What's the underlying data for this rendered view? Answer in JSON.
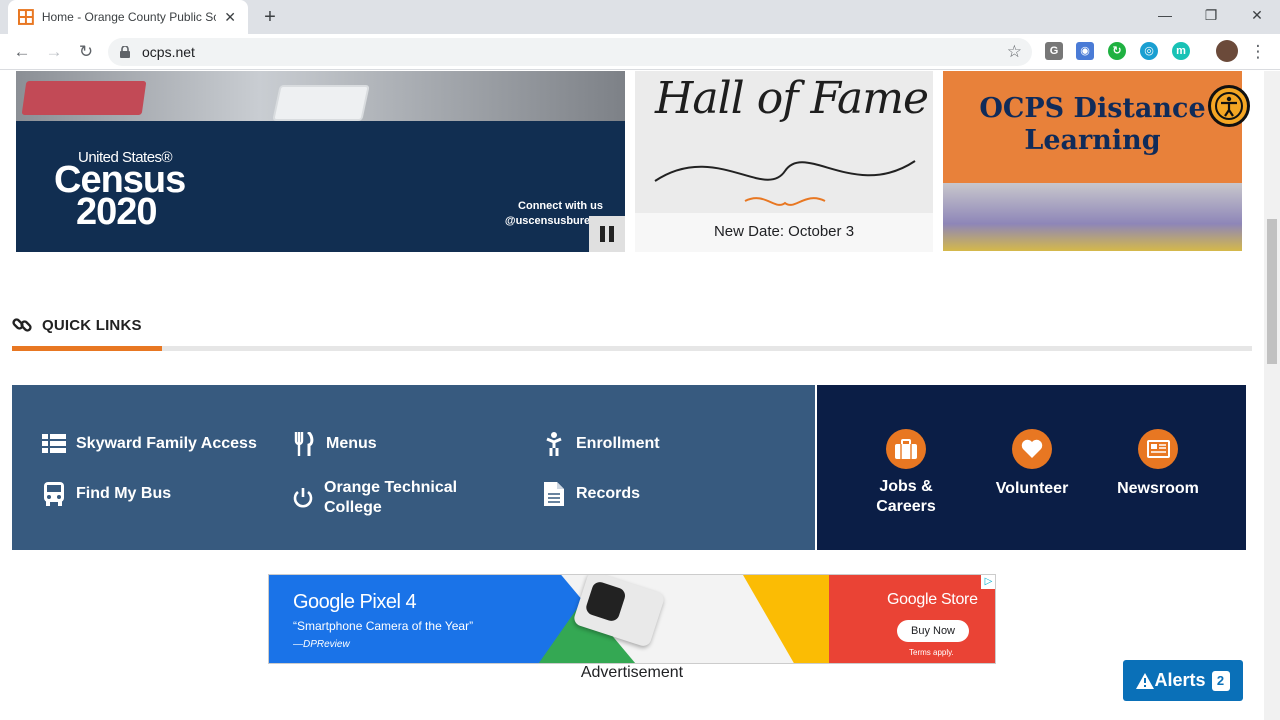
{
  "browser": {
    "tab_title": "Home - Orange County Public Sc",
    "tab_close": "✕",
    "new_tab": "+",
    "url": "ocps.net",
    "window_controls": [
      "—",
      "❐",
      "✕"
    ]
  },
  "hero": {
    "census": {
      "brand_line": "United States®",
      "brand_word": "Census",
      "brand_year": "2020",
      "connect": "Connect with us",
      "handle": "@uscensusbureau"
    },
    "hall_of_fame": {
      "script_title": "Hall of Fame",
      "caption": "New Date: October 3"
    },
    "distance_learning": {
      "title_line1": "OCPS Distance",
      "title_line2": "Learning"
    }
  },
  "quick_links": {
    "title": "QUICK LINKS",
    "items": [
      {
        "label": "Skyward Family Access",
        "icon": "list-icon"
      },
      {
        "label": "Menus",
        "icon": "utensils-icon"
      },
      {
        "label": "Enrollment",
        "icon": "child-icon"
      },
      {
        "label": "Find My Bus",
        "icon": "bus-icon"
      },
      {
        "label": "Orange Technical College",
        "icon": "power-icon"
      },
      {
        "label": "Records",
        "icon": "document-icon"
      }
    ],
    "featured": [
      {
        "label": "Jobs & Careers",
        "icon": "briefcase-icon"
      },
      {
        "label": "Volunteer",
        "icon": "heart-icon"
      },
      {
        "label": "Newsroom",
        "icon": "newspaper-icon"
      }
    ]
  },
  "ad": {
    "headline": "Google Pixel 4",
    "quote": "“Smartphone Camera of the Year”",
    "source": "—DPReview",
    "store": "Google Store",
    "cta": "Buy Now",
    "terms": "Terms apply.",
    "label": "Advertisement"
  },
  "alerts": {
    "label": "Alerts",
    "count": "2"
  },
  "colors": {
    "accent": "#e87722",
    "panel": "#375a7f",
    "navy": "#0b1e46",
    "alerts": "#0a70b8"
  }
}
